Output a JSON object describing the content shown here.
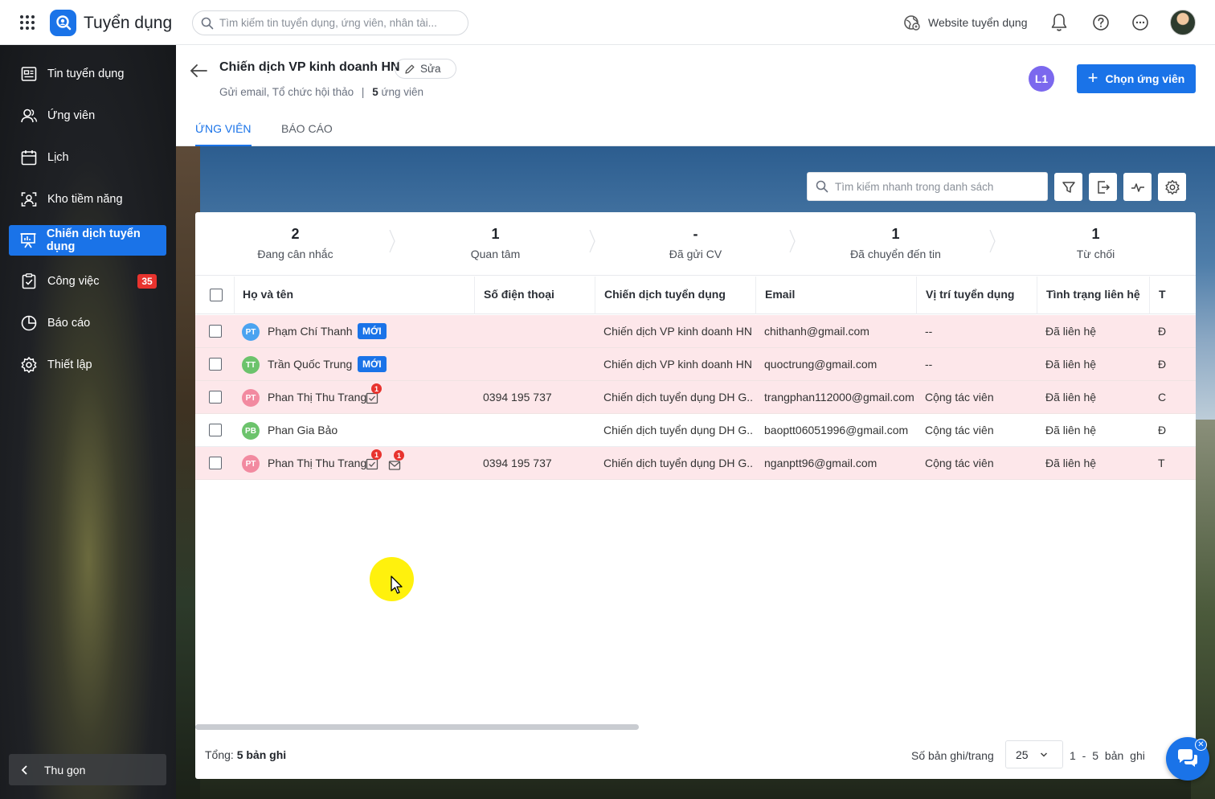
{
  "app": {
    "name": "Tuyển dụng",
    "search_placeholder": "Tìm kiếm tin tuyển dụng, ứng viên, nhân tài...",
    "website_link": "Website tuyển dụng",
    "accent_color": "#1a73e8"
  },
  "sidebar": {
    "items": [
      {
        "label": "Tin tuyển dụng",
        "icon": "newspaper-icon"
      },
      {
        "label": "Ứng viên",
        "icon": "users-icon"
      },
      {
        "label": "Lịch",
        "icon": "calendar-icon"
      },
      {
        "label": "Kho tiềm năng",
        "icon": "talent-pool-icon"
      },
      {
        "label": "Chiến dịch tuyển dụng",
        "icon": "presentation-icon",
        "active": true
      },
      {
        "label": "Công việc",
        "icon": "task-icon",
        "badge": "35"
      },
      {
        "label": "Báo cáo",
        "icon": "pie-chart-icon"
      },
      {
        "label": "Thiết lập",
        "icon": "gear-icon"
      }
    ],
    "collapse_label": "Thu gọn"
  },
  "header": {
    "title": "Chiến dịch VP kinh doanh HN",
    "edit_label": "Sửa",
    "subtitle_activities": "Gửi email, Tổ chức hội thảo",
    "subtitle_separator": "|",
    "candidate_count": "5",
    "candidate_count_label": "ứng viên",
    "user_initials": "L1",
    "choose_button": "Chọn ứng viên",
    "tabs": [
      {
        "label": "ỨNG VIÊN",
        "active": true
      },
      {
        "label": "BÁO CÁO",
        "active": false
      }
    ]
  },
  "toolbar": {
    "search_placeholder": "Tìm kiếm nhanh trong danh sách"
  },
  "stages": [
    {
      "count": "2",
      "name": "Đang cân nhắc"
    },
    {
      "count": "1",
      "name": "Quan tâm"
    },
    {
      "count": "-",
      "name": "Đã gửi CV"
    },
    {
      "count": "1",
      "name": "Đã chuyển đến tin"
    },
    {
      "count": "1",
      "name": "Từ chối"
    }
  ],
  "table": {
    "columns": [
      "Họ và tên",
      "Số điện thoại",
      "Chiến dịch tuyển dụng",
      "Email",
      "Vị trí tuyển dụng",
      "Tình trạng liên hệ",
      "T"
    ],
    "rows": [
      {
        "initials": "PT",
        "avatar_color": "#4aa3f0",
        "name": "Phạm Chí Thanh",
        "tag": "MỚI",
        "phone": "",
        "campaign": "Chiến dịch VP kinh doanh HN",
        "email": "chithanh@gmail.com",
        "position": "--",
        "contact_status": "Đã liên hệ",
        "extra": "Đ",
        "highlight": true
      },
      {
        "initials": "TT",
        "avatar_color": "#6cc36c",
        "name": "Trần Quốc Trung",
        "tag": "MỚI",
        "phone": "",
        "campaign": "Chiến dịch VP kinh doanh HN",
        "email": "quoctrung@gmail.com",
        "position": "--",
        "contact_status": "Đã liên hệ",
        "extra": "Đ",
        "highlight": true
      },
      {
        "initials": "PT",
        "avatar_color": "#f28aa0",
        "name": "Phan Thị Thu Trang",
        "tag": "",
        "task_count": "1",
        "phone": "0394 195 737",
        "campaign": "Chiến dịch tuyển dụng DH G...",
        "email": "trangphan112000@gmail.com",
        "position": "Cộng tác viên",
        "contact_status": "Đã liên hệ",
        "extra": "C",
        "highlight": true
      },
      {
        "initials": "PB",
        "avatar_color": "#6cc36c",
        "name": "Phan Gia Bảo",
        "tag": "",
        "phone": "",
        "campaign": "Chiến dịch tuyển dụng DH G...",
        "email": "baoptt06051996@gmail.com",
        "position": "Cộng tác viên",
        "contact_status": "Đã liên hệ",
        "extra": "Đ",
        "highlight": false
      },
      {
        "initials": "PT",
        "avatar_color": "#f28aa0",
        "name": "Phan Thị Thu Trang",
        "tag": "",
        "task_count": "1",
        "mail_count": "1",
        "phone": "0394 195 737",
        "campaign": "Chiến dịch tuyển dụng DH G...",
        "email": "nganptt96@gmail.com",
        "position": "Cộng tác viên",
        "contact_status": "Đã liên hệ",
        "extra": "T",
        "highlight": true
      }
    ]
  },
  "footer": {
    "total_label": "Tổng:",
    "total_value": "5 bản ghi",
    "per_page_label": "Số bản ghi/trang",
    "per_page_value": "25",
    "range": "1 - 5 bản ghi"
  }
}
